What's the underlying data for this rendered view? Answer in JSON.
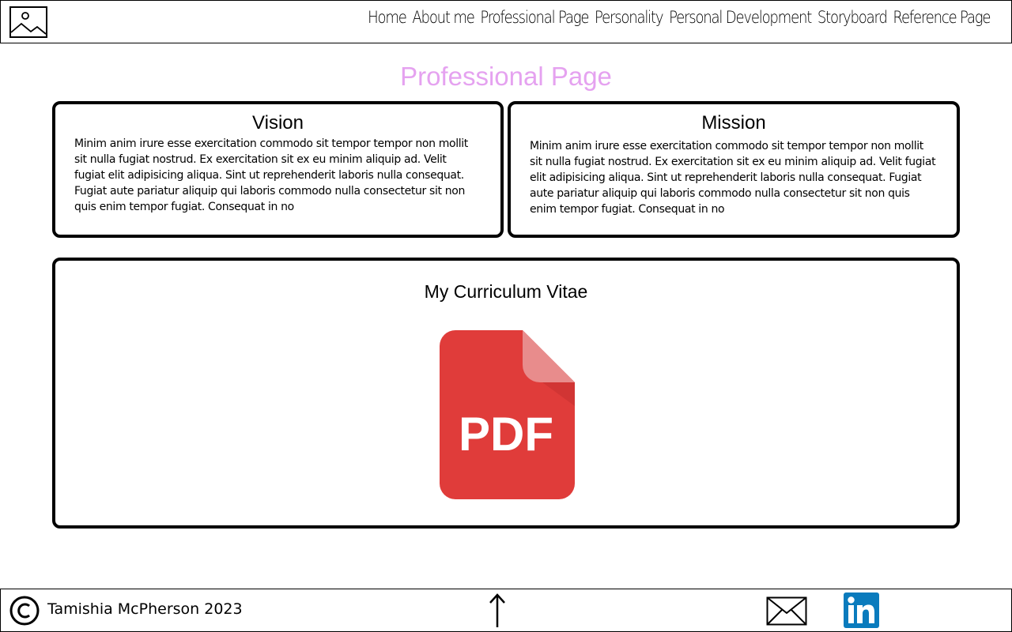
{
  "header": {
    "logo_icon": "image-placeholder-icon",
    "nav": [
      {
        "label": "Home"
      },
      {
        "label": "About me"
      },
      {
        "label": "Professional Page"
      },
      {
        "label": "Personality"
      },
      {
        "label": "Personal Development"
      },
      {
        "label": "Storyboard"
      },
      {
        "label": "Reference Page"
      }
    ]
  },
  "main": {
    "title": "Professional Page",
    "title_color": "#e5a2f0",
    "vision": {
      "title": "Vision",
      "text": "Minim anim irure esse exercitation commodo sit tempor tempor non mollit sit nulla fugiat nostrud. Ex exercitation sit ex eu minim aliquip ad. Velit fugiat elit adipisicing aliqua. Sint ut reprehenderit laboris nulla consequat. Fugiat aute pariatur aliquip qui laboris commodo nulla consectetur sit non quis enim tempor fugiat. Consequat in no"
    },
    "mission": {
      "title": "Mission",
      "text": "Minim anim irure esse exercitation commodo sit tempor tempor non mollit sit nulla fugiat nostrud. Ex exercitation sit ex eu minim aliquip ad. Velit fugiat elit adipisicing aliqua. Sint ut reprehenderit laboris nulla consequat. Fugiat aute pariatur aliquip qui laboris commodo nulla consectetur sit non quis enim tempor fugiat. Consequat in no"
    },
    "cv": {
      "title": "My Curriculum Vitae",
      "pdf_label": "PDF",
      "pdf_color": "#e03c3a"
    }
  },
  "footer": {
    "copyright_icon": "copyright-icon",
    "name": "Tamishia McPherson 2023",
    "icons": [
      "up-arrow-icon",
      "mail-icon",
      "linkedin-icon"
    ],
    "linkedin_color": "#0a7bbd"
  }
}
